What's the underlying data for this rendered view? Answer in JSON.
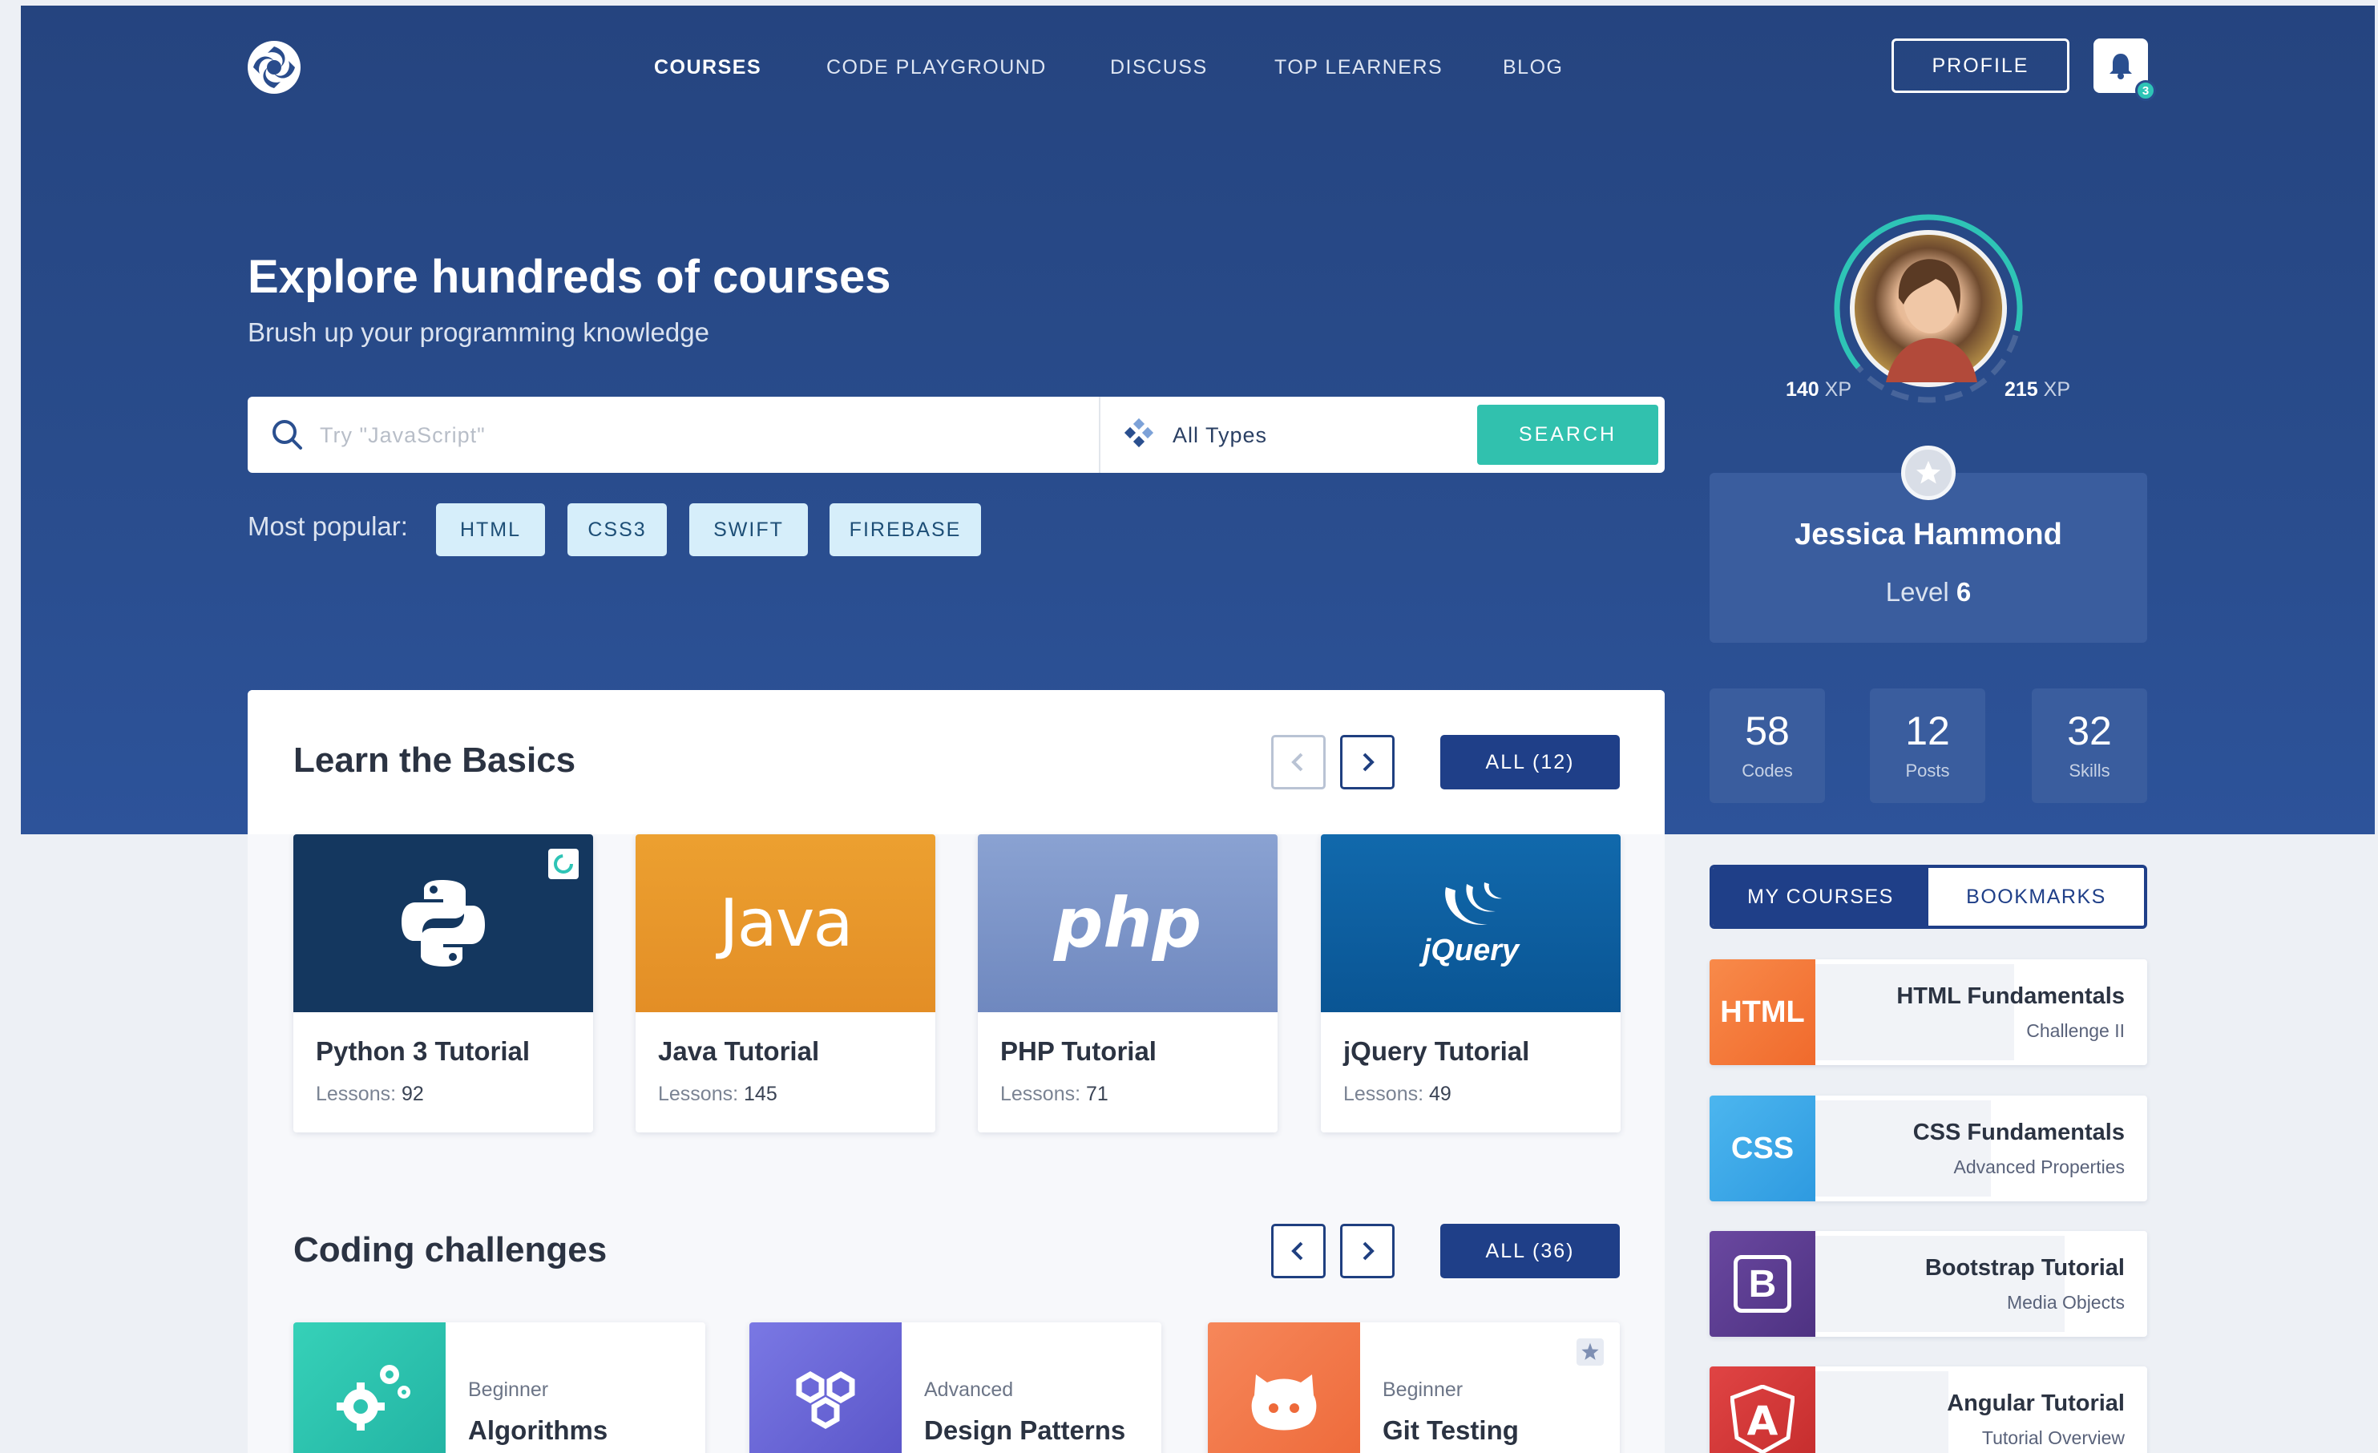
{
  "nav": {
    "items": [
      {
        "label": "COURSES",
        "active": true
      },
      {
        "label": "CODE PLAYGROUND",
        "active": false
      },
      {
        "label": "DISCUSS",
        "active": false
      },
      {
        "label": "TOP LEARNERS",
        "active": false
      },
      {
        "label": "BLOG",
        "active": false
      }
    ],
    "profile_label": "PROFILE",
    "notification_count": "3"
  },
  "hero": {
    "title": "Explore hundreds of courses",
    "subtitle": "Brush up your programming knowledge"
  },
  "search": {
    "placeholder": "Try \"JavaScript\"",
    "type_value": "All Types",
    "button_label": "SEARCH",
    "popular_label": "Most popular:",
    "popular_tags": [
      "HTML",
      "CSS3",
      "SWIFT",
      "FIREBASE"
    ]
  },
  "profile": {
    "xp_current": "140",
    "xp_next": "215",
    "xp_unit": "XP",
    "xp_progress": 0.65,
    "name": "Jessica Hammond",
    "level_label": "Level",
    "level_value": "6",
    "stats": [
      {
        "value": "58",
        "label": "Codes"
      },
      {
        "value": "12",
        "label": "Posts"
      },
      {
        "value": "32",
        "label": "Skills"
      }
    ]
  },
  "basics": {
    "title": "Learn the Basics",
    "all_label": "ALL (12)",
    "lessons_label": "Lessons:",
    "courses": [
      {
        "title": "Python 3 Tutorial",
        "lessons": "92",
        "color": "#14375f",
        "icon": "python-icon"
      },
      {
        "title": "Java Tutorial",
        "lessons": "145",
        "color": "#e8952a",
        "icon": "java-logo",
        "logo_text": "Java"
      },
      {
        "title": "PHP Tutorial",
        "lessons": "71",
        "color": "#7c95c6",
        "icon": "php-logo",
        "logo_text": "php"
      },
      {
        "title": "jQuery Tutorial",
        "lessons": "49",
        "color": "#0e5b9e",
        "icon": "jquery-logo",
        "logo_text": "jQuery"
      }
    ]
  },
  "challenges": {
    "title": "Coding challenges",
    "all_label": "ALL (36)",
    "items": [
      {
        "level": "Beginner",
        "name": "Algorithms",
        "color": "#2ec4b0",
        "icon": "gears-icon"
      },
      {
        "level": "Advanced",
        "name": "Design Patterns",
        "color": "#6a67d8",
        "icon": "hexagons-icon"
      },
      {
        "level": "Beginner",
        "name": "Git Testing",
        "color": "#f27748",
        "icon": "github-icon"
      }
    ]
  },
  "my_courses": {
    "tabs": [
      {
        "label": "MY COURSES",
        "active": true
      },
      {
        "label": "BOOKMARKS",
        "active": false
      }
    ],
    "items": [
      {
        "name": "HTML Fundamentals",
        "sub": "Challenge II",
        "icon_text": "HTML",
        "color": "#f47b3b",
        "progress": 0.6
      },
      {
        "name": "CSS Fundamentals",
        "sub": "Advanced Properties",
        "icon_text": "CSS",
        "color": "#3ba8e8",
        "progress": 0.53
      },
      {
        "name": "Bootstrap Tutorial",
        "sub": "Media Objects",
        "icon_text": "B",
        "color": "#5a3a8c",
        "progress": 0.75
      },
      {
        "name": "Angular Tutorial",
        "sub": "Tutorial Overview",
        "icon_text": "A",
        "color": "#d63a3a",
        "progress": 0.4
      }
    ]
  },
  "colors": {
    "hero_bg": "#294c8c",
    "accent_teal": "#31c1ae",
    "primary_blue": "#1f3f88"
  }
}
